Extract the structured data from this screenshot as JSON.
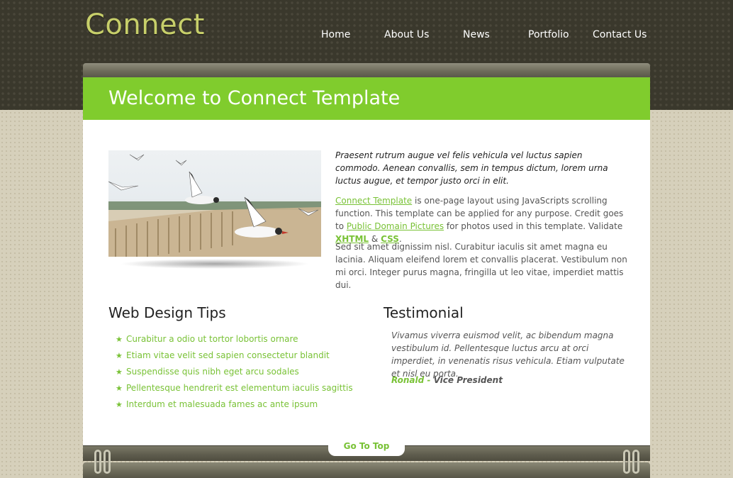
{
  "brand": {
    "logo_text": "Connect"
  },
  "nav": {
    "items": [
      "Home",
      "About Us",
      "News",
      "Portfolio",
      "Contact Us"
    ]
  },
  "page": {
    "title": "Welcome to Connect Template"
  },
  "intro": {
    "italic": "Praesent rutrum augue vel felis vehicula vel luctus sapien commodo. Aenean convallis, sem in tempus dictum, lorem urna luctus augue, et tempor justo orci in elit.",
    "p2_link1": "Connect Template",
    "p2_text1": " is one-page layout using JavaScripts scrolling function. This template can be applied for any purpose. Credit goes to ",
    "p2_link2": "Public Domain Pictures",
    "p2_text2": " for photos used in this template. Validate ",
    "p2_link3": "XHTML",
    "p2_amp": " & ",
    "p2_link4": "CSS",
    "p2_end": ".",
    "p3": "Sed sit amet dignissim nisl. Curabitur iaculis sit amet magna eu lacinia. Aliquam eleifend lorem et convallis placerat. Vestibulum non mi orci. Integer purus magna, fringilla ut leo vitae, imperdiet mattis dui."
  },
  "tips": {
    "heading": "Web Design Tips",
    "items": [
      "Curabitur a odio ut tortor lobortis ornare",
      "Etiam vitae velit sed sapien consectetur blandit",
      "Suspendisse quis nibh eget arcu sodales",
      "Pellentesque hendrerit est elementum iaculis sagittis",
      "Interdum et malesuada fames ac ante ipsum"
    ]
  },
  "testimonial": {
    "heading": "Testimonial",
    "quote": "Vivamus viverra euismod velit, ac bibendum magna vestibulum id. Pellentesque luctus arcu at orci imperdiet, in venenatis risus vehicula. Etiam vulputate et nisl eu porta.",
    "author": "Ronald",
    "dash": " - ",
    "role": "Vice President"
  },
  "footer": {
    "go_to_top": "Go To Top"
  },
  "colors": {
    "accent": "#80cc2d",
    "header": "#3a382c",
    "link": "#79c236"
  }
}
